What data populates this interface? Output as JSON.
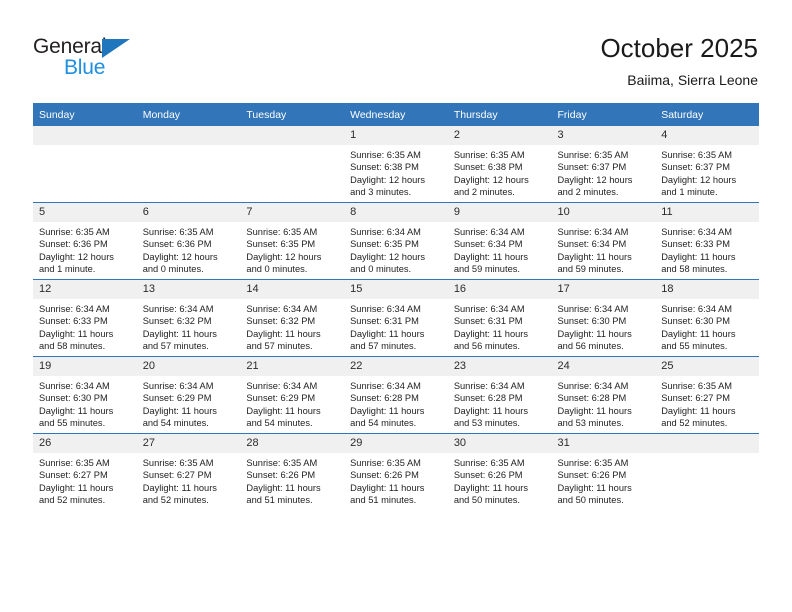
{
  "brand": {
    "logo_text_top": "General",
    "logo_text_bottom": "Blue",
    "logo_dark_color": "#231f20",
    "logo_blue_color": "#1f8fe0",
    "logo_triangle_color": "#1f76bc"
  },
  "header": {
    "month_title": "October 2025",
    "location": "Baiima, Sierra Leone"
  },
  "theme": {
    "header_blue": "#3275b8",
    "daynum_band": "#f0f0f0",
    "text": "#1f1f1f"
  },
  "weekday_headers": [
    "Sunday",
    "Monday",
    "Tuesday",
    "Wednesday",
    "Thursday",
    "Friday",
    "Saturday"
  ],
  "weeks": [
    [
      {
        "day": "",
        "sunrise": "",
        "sunset": "",
        "daylight_line1": "",
        "daylight_line2": ""
      },
      {
        "day": "",
        "sunrise": "",
        "sunset": "",
        "daylight_line1": "",
        "daylight_line2": ""
      },
      {
        "day": "",
        "sunrise": "",
        "sunset": "",
        "daylight_line1": "",
        "daylight_line2": ""
      },
      {
        "day": "1",
        "sunrise": "Sunrise: 6:35 AM",
        "sunset": "Sunset: 6:38 PM",
        "daylight_line1": "Daylight: 12 hours",
        "daylight_line2": "and 3 minutes."
      },
      {
        "day": "2",
        "sunrise": "Sunrise: 6:35 AM",
        "sunset": "Sunset: 6:38 PM",
        "daylight_line1": "Daylight: 12 hours",
        "daylight_line2": "and 2 minutes."
      },
      {
        "day": "3",
        "sunrise": "Sunrise: 6:35 AM",
        "sunset": "Sunset: 6:37 PM",
        "daylight_line1": "Daylight: 12 hours",
        "daylight_line2": "and 2 minutes."
      },
      {
        "day": "4",
        "sunrise": "Sunrise: 6:35 AM",
        "sunset": "Sunset: 6:37 PM",
        "daylight_line1": "Daylight: 12 hours",
        "daylight_line2": "and 1 minute."
      }
    ],
    [
      {
        "day": "5",
        "sunrise": "Sunrise: 6:35 AM",
        "sunset": "Sunset: 6:36 PM",
        "daylight_line1": "Daylight: 12 hours",
        "daylight_line2": "and 1 minute."
      },
      {
        "day": "6",
        "sunrise": "Sunrise: 6:35 AM",
        "sunset": "Sunset: 6:36 PM",
        "daylight_line1": "Daylight: 12 hours",
        "daylight_line2": "and 0 minutes."
      },
      {
        "day": "7",
        "sunrise": "Sunrise: 6:35 AM",
        "sunset": "Sunset: 6:35 PM",
        "daylight_line1": "Daylight: 12 hours",
        "daylight_line2": "and 0 minutes."
      },
      {
        "day": "8",
        "sunrise": "Sunrise: 6:34 AM",
        "sunset": "Sunset: 6:35 PM",
        "daylight_line1": "Daylight: 12 hours",
        "daylight_line2": "and 0 minutes."
      },
      {
        "day": "9",
        "sunrise": "Sunrise: 6:34 AM",
        "sunset": "Sunset: 6:34 PM",
        "daylight_line1": "Daylight: 11 hours",
        "daylight_line2": "and 59 minutes."
      },
      {
        "day": "10",
        "sunrise": "Sunrise: 6:34 AM",
        "sunset": "Sunset: 6:34 PM",
        "daylight_line1": "Daylight: 11 hours",
        "daylight_line2": "and 59 minutes."
      },
      {
        "day": "11",
        "sunrise": "Sunrise: 6:34 AM",
        "sunset": "Sunset: 6:33 PM",
        "daylight_line1": "Daylight: 11 hours",
        "daylight_line2": "and 58 minutes."
      }
    ],
    [
      {
        "day": "12",
        "sunrise": "Sunrise: 6:34 AM",
        "sunset": "Sunset: 6:33 PM",
        "daylight_line1": "Daylight: 11 hours",
        "daylight_line2": "and 58 minutes."
      },
      {
        "day": "13",
        "sunrise": "Sunrise: 6:34 AM",
        "sunset": "Sunset: 6:32 PM",
        "daylight_line1": "Daylight: 11 hours",
        "daylight_line2": "and 57 minutes."
      },
      {
        "day": "14",
        "sunrise": "Sunrise: 6:34 AM",
        "sunset": "Sunset: 6:32 PM",
        "daylight_line1": "Daylight: 11 hours",
        "daylight_line2": "and 57 minutes."
      },
      {
        "day": "15",
        "sunrise": "Sunrise: 6:34 AM",
        "sunset": "Sunset: 6:31 PM",
        "daylight_line1": "Daylight: 11 hours",
        "daylight_line2": "and 57 minutes."
      },
      {
        "day": "16",
        "sunrise": "Sunrise: 6:34 AM",
        "sunset": "Sunset: 6:31 PM",
        "daylight_line1": "Daylight: 11 hours",
        "daylight_line2": "and 56 minutes."
      },
      {
        "day": "17",
        "sunrise": "Sunrise: 6:34 AM",
        "sunset": "Sunset: 6:30 PM",
        "daylight_line1": "Daylight: 11 hours",
        "daylight_line2": "and 56 minutes."
      },
      {
        "day": "18",
        "sunrise": "Sunrise: 6:34 AM",
        "sunset": "Sunset: 6:30 PM",
        "daylight_line1": "Daylight: 11 hours",
        "daylight_line2": "and 55 minutes."
      }
    ],
    [
      {
        "day": "19",
        "sunrise": "Sunrise: 6:34 AM",
        "sunset": "Sunset: 6:30 PM",
        "daylight_line1": "Daylight: 11 hours",
        "daylight_line2": "and 55 minutes."
      },
      {
        "day": "20",
        "sunrise": "Sunrise: 6:34 AM",
        "sunset": "Sunset: 6:29 PM",
        "daylight_line1": "Daylight: 11 hours",
        "daylight_line2": "and 54 minutes."
      },
      {
        "day": "21",
        "sunrise": "Sunrise: 6:34 AM",
        "sunset": "Sunset: 6:29 PM",
        "daylight_line1": "Daylight: 11 hours",
        "daylight_line2": "and 54 minutes."
      },
      {
        "day": "22",
        "sunrise": "Sunrise: 6:34 AM",
        "sunset": "Sunset: 6:28 PM",
        "daylight_line1": "Daylight: 11 hours",
        "daylight_line2": "and 54 minutes."
      },
      {
        "day": "23",
        "sunrise": "Sunrise: 6:34 AM",
        "sunset": "Sunset: 6:28 PM",
        "daylight_line1": "Daylight: 11 hours",
        "daylight_line2": "and 53 minutes."
      },
      {
        "day": "24",
        "sunrise": "Sunrise: 6:34 AM",
        "sunset": "Sunset: 6:28 PM",
        "daylight_line1": "Daylight: 11 hours",
        "daylight_line2": "and 53 minutes."
      },
      {
        "day": "25",
        "sunrise": "Sunrise: 6:35 AM",
        "sunset": "Sunset: 6:27 PM",
        "daylight_line1": "Daylight: 11 hours",
        "daylight_line2": "and 52 minutes."
      }
    ],
    [
      {
        "day": "26",
        "sunrise": "Sunrise: 6:35 AM",
        "sunset": "Sunset: 6:27 PM",
        "daylight_line1": "Daylight: 11 hours",
        "daylight_line2": "and 52 minutes."
      },
      {
        "day": "27",
        "sunrise": "Sunrise: 6:35 AM",
        "sunset": "Sunset: 6:27 PM",
        "daylight_line1": "Daylight: 11 hours",
        "daylight_line2": "and 52 minutes."
      },
      {
        "day": "28",
        "sunrise": "Sunrise: 6:35 AM",
        "sunset": "Sunset: 6:26 PM",
        "daylight_line1": "Daylight: 11 hours",
        "daylight_line2": "and 51 minutes."
      },
      {
        "day": "29",
        "sunrise": "Sunrise: 6:35 AM",
        "sunset": "Sunset: 6:26 PM",
        "daylight_line1": "Daylight: 11 hours",
        "daylight_line2": "and 51 minutes."
      },
      {
        "day": "30",
        "sunrise": "Sunrise: 6:35 AM",
        "sunset": "Sunset: 6:26 PM",
        "daylight_line1": "Daylight: 11 hours",
        "daylight_line2": "and 50 minutes."
      },
      {
        "day": "31",
        "sunrise": "Sunrise: 6:35 AM",
        "sunset": "Sunset: 6:26 PM",
        "daylight_line1": "Daylight: 11 hours",
        "daylight_line2": "and 50 minutes."
      },
      {
        "day": "",
        "sunrise": "",
        "sunset": "",
        "daylight_line1": "",
        "daylight_line2": ""
      }
    ]
  ]
}
